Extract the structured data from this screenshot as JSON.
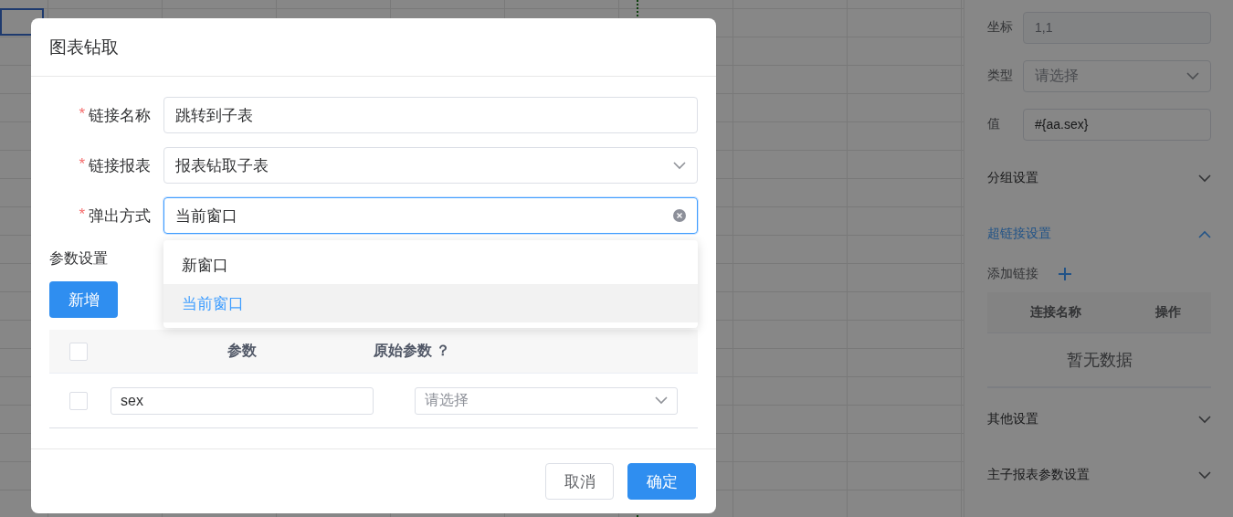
{
  "side_panel": {
    "fields": [
      {
        "kind": "input",
        "label": "坐标",
        "value": "1,1",
        "disabled": true
      },
      {
        "kind": "select",
        "label": "类型",
        "placeholder": "请选择"
      },
      {
        "kind": "input",
        "label": "值",
        "value": "#{aa.sex}"
      }
    ],
    "sections": [
      {
        "title": "分组设置",
        "expanded": false
      },
      {
        "title": "超链接设置",
        "expanded": true,
        "add_label": "添加链接",
        "columns": [
          "连接名称",
          "操作"
        ],
        "empty_text": "暂无数据"
      },
      {
        "title": "其他设置",
        "expanded": false
      },
      {
        "title": "主子报表参数设置",
        "expanded": false
      }
    ]
  },
  "dialog": {
    "title": "图表钻取",
    "required_mark": "*",
    "fields": [
      {
        "kind": "input",
        "label": "链接名称",
        "required": true,
        "value": "跳转到子表",
        "focused": false
      },
      {
        "kind": "select",
        "label": "链接报表",
        "required": true,
        "value": "报表钻取子表",
        "focused": false
      },
      {
        "kind": "select",
        "label": "弹出方式",
        "required": true,
        "value": "当前窗口",
        "focused": true
      }
    ],
    "dropdown": {
      "options": [
        {
          "label": "新窗口",
          "selected": false
        },
        {
          "label": "当前窗口",
          "selected": true
        }
      ]
    },
    "params": {
      "title": "参数设置",
      "add_button": "新增",
      "header_checked": false,
      "columns": [
        "参数",
        "原始参数 ？"
      ],
      "rows": [
        {
          "checked": false,
          "param": "sex",
          "source_placeholder": "请选择"
        }
      ]
    },
    "buttons": [
      {
        "kind": "default",
        "label": "取消"
      },
      {
        "kind": "primary",
        "label": "确定"
      }
    ]
  }
}
